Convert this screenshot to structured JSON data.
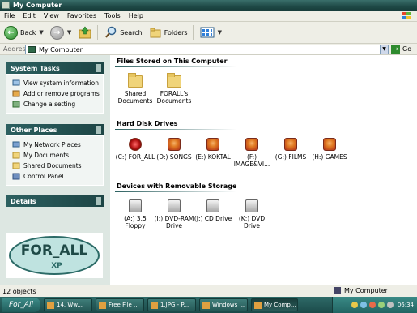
{
  "window": {
    "title": "My Computer"
  },
  "menu": [
    "File",
    "Edit",
    "View",
    "Favorites",
    "Tools",
    "Help"
  ],
  "toolbar": {
    "back": "Back",
    "search": "Search",
    "folders": "Folders"
  },
  "address": {
    "label": "Address",
    "value": "My Computer",
    "go": "Go"
  },
  "left_panel": {
    "system_tasks": {
      "title": "System Tasks",
      "items": [
        "View system information",
        "Add or remove programs",
        "Change a setting"
      ]
    },
    "other_places": {
      "title": "Other Places",
      "items": [
        "My Network Places",
        "My Documents",
        "Shared Documents",
        "Control Panel"
      ]
    },
    "details": {
      "title": "Details"
    },
    "logo": {
      "text": "FOR_ALL",
      "badge": "XP"
    }
  },
  "sections": {
    "stored": {
      "title": "Files Stored on This Computer",
      "items": [
        "Shared Documents",
        "FORALL's Documents"
      ]
    },
    "hdd": {
      "title": "Hard Disk Drives",
      "items": [
        "(C:) FOR_ALL",
        "(D:) SONGS",
        "(E:) KOKTAL",
        "(F:) IMAGE&VI...",
        "(G:) FILMS",
        "(H:) GAMES"
      ]
    },
    "removable": {
      "title": "Devices with Removable Storage",
      "items": [
        "(A:) 3.5 Floppy",
        "(I:) DVD-RAM Drive",
        "(J:) CD Drive",
        "(K:) DVD Drive"
      ]
    }
  },
  "status": {
    "count": "12 objects",
    "location": "My Computer"
  },
  "taskbar": {
    "start": "For_All",
    "tasks": [
      "14. Ww...",
      "Free File ...",
      "1.JPG - P...",
      "Windows ...",
      "My Comp..."
    ],
    "clock": "06:34"
  },
  "colors": {
    "accent": "#1f4a47",
    "panel": "#dde7e2"
  }
}
